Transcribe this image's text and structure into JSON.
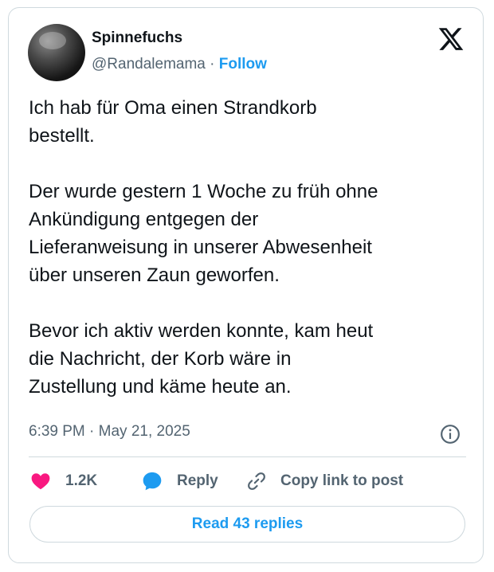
{
  "author": {
    "display_name": "Spinnefuchs",
    "handle": "@Randalemama",
    "separator": " · ",
    "follow_label": "Follow"
  },
  "tweet": {
    "text": "Ich hab für Oma einen Strandkorb\nbestellt.\n\nDer wurde gestern 1 Woche zu früh ohne\nAnkündigung entgegen der\nLieferanweisung in unserer Abwesenheit\nüber unseren Zaun geworfen.\n\nBevor ich aktiv werden konnte, kam heut\ndie Nachricht, der Korb wäre in\nZustellung und käme heute an.",
    "timestamp": "6:39 PM · May 21, 2025"
  },
  "actions": {
    "like_count": "1.2K",
    "reply_label": "Reply",
    "copy_link_label": "Copy link to post"
  },
  "read_replies_label": "Read 43 replies",
  "icons": {
    "platform": "x-logo-icon",
    "info": "info-icon",
    "like": "heart-icon",
    "reply": "speech-bubble-icon",
    "copy": "link-icon"
  },
  "colors": {
    "accent": "#1d9bf0",
    "like": "#f91880",
    "secondary_text": "#536471",
    "border": "#cfd9de"
  }
}
